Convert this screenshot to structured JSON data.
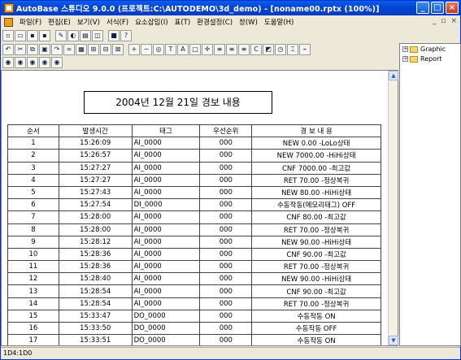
{
  "titlebar": {
    "title": "AutoBase 스튜디오 9.0.0 (프로젝트:C:\\AUTODEMO\\3d_demo) - [noname00.rptx (100%)]",
    "min": "_",
    "max": "□",
    "close": "×"
  },
  "menu": {
    "items": [
      "파일(F)",
      "편집(E)",
      "보기(V)",
      "서식(F)",
      "요소삽입(I)",
      "표(T)",
      "환경설정(C)",
      "창(W)",
      "도움말(H)"
    ],
    "mdi_controls": [
      "_",
      "▫",
      "×"
    ]
  },
  "toolbars": {
    "row1": [
      "new-doc",
      "open",
      "save",
      "save-all",
      "tool",
      "paint",
      "window",
      "layout",
      "print-preview",
      "help"
    ],
    "row2": [
      "undo",
      "cut",
      "copy",
      "paste",
      "redo",
      "link",
      "table",
      "insert-row",
      "insert-col",
      "merge",
      "zoom-in",
      "zoom-out",
      "zoom-fit",
      "text",
      "textbox",
      "frame",
      "expand",
      "align-left",
      "align-center",
      "align-right",
      "color",
      "image",
      "clock",
      "tag",
      "trend"
    ],
    "row3": [
      "view1",
      "view2",
      "view3",
      "view4",
      "view5"
    ]
  },
  "tree": {
    "items": [
      {
        "label": "Graphic",
        "expander": "+"
      },
      {
        "label": "Report",
        "expander": "+"
      }
    ]
  },
  "report": {
    "title": "2004년 12월 21일 경보 내용",
    "columns": [
      "순서",
      "발생시간",
      "태그",
      "우선순위",
      "경  보  내  용"
    ],
    "rows": [
      [
        "1",
        "15:26:09",
        "AI_0000",
        "000",
        "NEW  0.00 -LoLo상태"
      ],
      [
        "2",
        "15:26:57",
        "AI_0000",
        "000",
        "NEW  7000.00  -HiHi상태"
      ],
      [
        "3",
        "15:27:27",
        "AI_0000",
        "000",
        "CNF  7000.00 -최고값"
      ],
      [
        "4",
        "15:27:27",
        "AI_0000",
        "000",
        "RET  70.00 -정상복귀"
      ],
      [
        "5",
        "15:27:43",
        "AI_0000",
        "000",
        "NEW  80.00  -HiHi상태"
      ],
      [
        "6",
        "15:27:54",
        "DI_0000",
        "000",
        "수동작동(메모리태그) OFF"
      ],
      [
        "7",
        "15:28:00",
        "AI_0000",
        "000",
        "CNF  80.00 -최고값"
      ],
      [
        "8",
        "15:28:00",
        "AI_0000",
        "000",
        "RET  70.00 -정상복귀"
      ],
      [
        "9",
        "15:28:12",
        "AI_0000",
        "000",
        "NEW  90.00  -HiHi상태"
      ],
      [
        "10",
        "15:28:36",
        "AI_0000",
        "000",
        "CNF  90.00 -최고값"
      ],
      [
        "11",
        "15:28:36",
        "AI_0000",
        "000",
        "RET  70.00 -정상복귀"
      ],
      [
        "12",
        "15:28:40",
        "AI_0000",
        "000",
        "NEW  90.00  -HiHi상태"
      ],
      [
        "13",
        "15:28:54",
        "AI_0000",
        "000",
        "CNF  90.00 -최고값"
      ],
      [
        "14",
        "15:28:54",
        "AI_0000",
        "000",
        "RET  70.00 -정상복귀"
      ],
      [
        "15",
        "15:33:47",
        "DO_0000",
        "000",
        "수동작동 ON"
      ],
      [
        "16",
        "15:33:50",
        "DO_0000",
        "000",
        "수동작동 OFF"
      ],
      [
        "17",
        "15:33:51",
        "DO_0000",
        "000",
        "수동작동 ON"
      ]
    ]
  },
  "scrollbar": {
    "up": "▲",
    "down": "▼"
  },
  "status": {
    "text": "1D4:1D0"
  },
  "colors": {
    "titlebar": "#0A5FE8",
    "window_bg": "#ECE9D8",
    "folder": "#F6D66B"
  }
}
